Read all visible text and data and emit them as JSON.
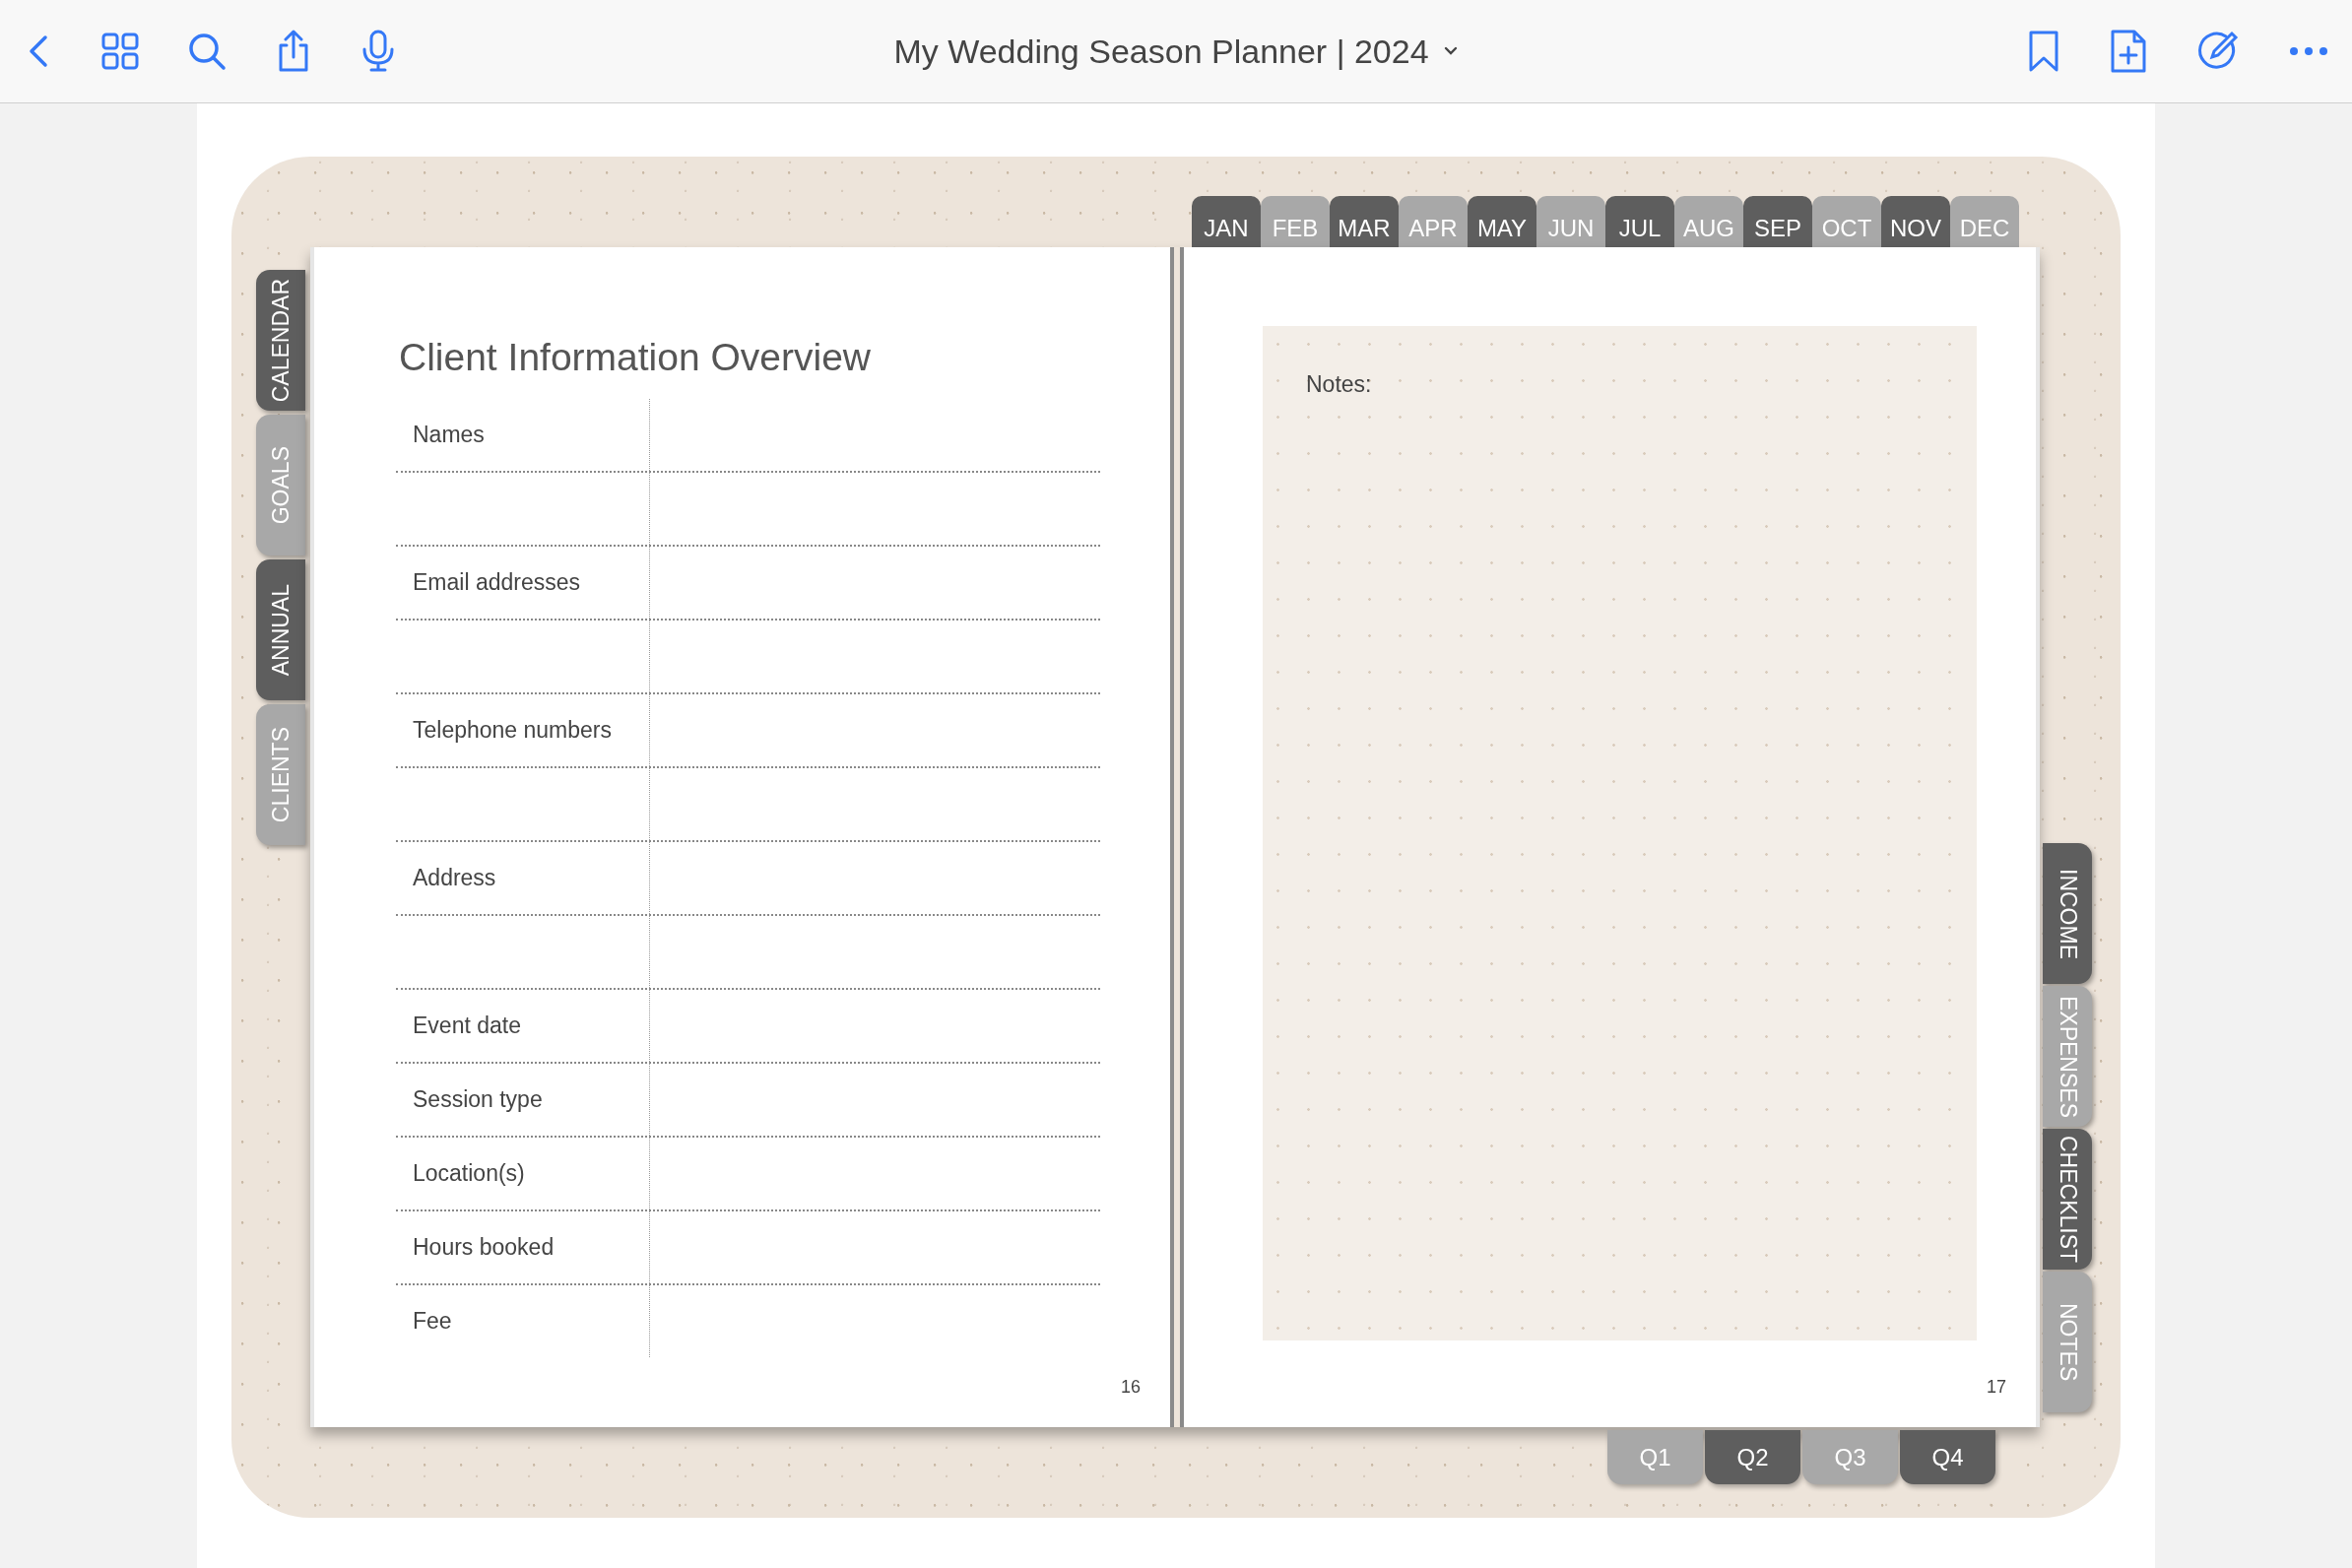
{
  "window": {
    "title": "My Wedding Season Planner | 2024"
  },
  "month_tabs": [
    {
      "label": "JAN",
      "color": "#5e5e5e"
    },
    {
      "label": "FEB",
      "color": "#a8a8a8"
    },
    {
      "label": "MAR",
      "color": "#5e5e5e"
    },
    {
      "label": "APR",
      "color": "#a8a8a8"
    },
    {
      "label": "MAY",
      "color": "#5e5e5e"
    },
    {
      "label": "JUN",
      "color": "#a8a8a8"
    },
    {
      "label": "JUL",
      "color": "#5e5e5e"
    },
    {
      "label": "AUG",
      "color": "#a8a8a8"
    },
    {
      "label": "SEP",
      "color": "#5e5e5e"
    },
    {
      "label": "OCT",
      "color": "#a8a8a8"
    },
    {
      "label": "NOV",
      "color": "#5e5e5e"
    },
    {
      "label": "DEC",
      "color": "#a8a8a8"
    }
  ],
  "left_tabs": [
    {
      "label": "CALENDAR",
      "color": "#5e5e5e"
    },
    {
      "label": "GOALS",
      "color": "#a8a8a8"
    },
    {
      "label": "ANNUAL",
      "color": "#5e5e5e"
    },
    {
      "label": "CLIENTS",
      "color": "#a8a8a8"
    }
  ],
  "right_tabs": [
    {
      "label": "INCOME",
      "color": "#5e5e5e"
    },
    {
      "label": "EXPENSES",
      "color": "#a8a8a8"
    },
    {
      "label": "CHECKLIST",
      "color": "#5e5e5e"
    },
    {
      "label": "NOTES",
      "color": "#a8a8a8"
    }
  ],
  "quarter_tabs": [
    {
      "label": "Q1",
      "color": "#a8a8a8"
    },
    {
      "label": "Q2",
      "color": "#5e5e5e"
    },
    {
      "label": "Q3",
      "color": "#a8a8a8"
    },
    {
      "label": "Q4",
      "color": "#5e5e5e"
    }
  ],
  "left_page": {
    "title": "Client Information Overview",
    "rows": [
      {
        "kind": "label",
        "label": "Names"
      },
      {
        "kind": "blank"
      },
      {
        "kind": "label",
        "label": "Email addresses"
      },
      {
        "kind": "blank"
      },
      {
        "kind": "label",
        "label": "Telephone numbers"
      },
      {
        "kind": "blank"
      },
      {
        "kind": "label",
        "label": "Address"
      },
      {
        "kind": "blank"
      },
      {
        "kind": "label",
        "label": "Event date"
      },
      {
        "kind": "label",
        "label": "Session type"
      },
      {
        "kind": "label",
        "label": "Location(s)"
      },
      {
        "kind": "label",
        "label": "Hours booked"
      },
      {
        "kind": "label",
        "label": "Fee"
      }
    ],
    "page_number": "16"
  },
  "right_page": {
    "notes_label": "Notes:",
    "page_number": "17"
  }
}
